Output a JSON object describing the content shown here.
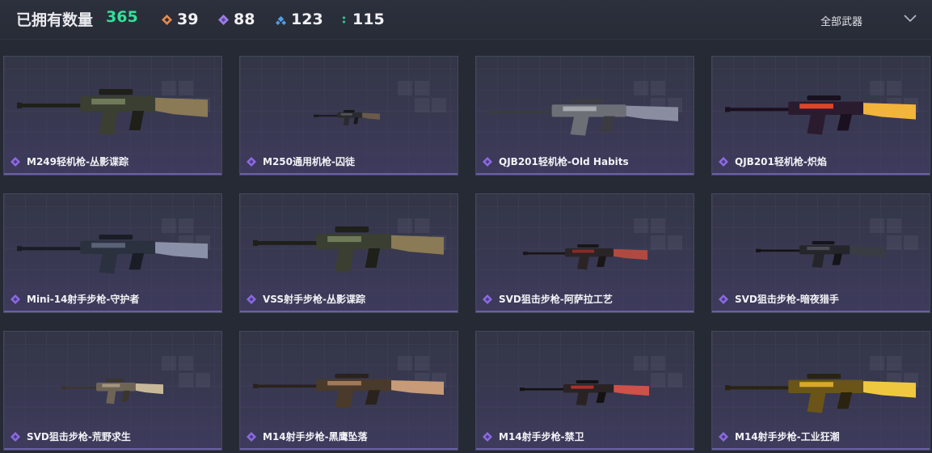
{
  "header": {
    "owned_label": "已拥有数量",
    "owned_count": "365",
    "stats": [
      {
        "icon": "orange-diamond-icon",
        "value": "39",
        "color": "#e58a4a"
      },
      {
        "icon": "purple-diamond-icon",
        "value": "88",
        "color": "#9d7de6"
      },
      {
        "icon": "blue-diamond-icon",
        "value": "123",
        "color": "#4f9fe6"
      },
      {
        "icon": "green-dot-icon",
        "value": "115",
        "color": "#2fd6a0"
      }
    ],
    "filter_label": "全部武器"
  },
  "colors": {
    "accent_green": "#2fe39a",
    "rarity_purple": "#8c6be0",
    "card_bg": "#333646"
  },
  "weapons": [
    {
      "name": "M249轻机枪-丛影谍踪",
      "rarity": "purple-diamond-icon",
      "skin": "camo-green"
    },
    {
      "name": "M250通用机枪-囚徒",
      "rarity": "purple-diamond-icon",
      "skin": "dark-small"
    },
    {
      "name": "QJB201轻机枪-Old Habits",
      "rarity": "purple-diamond-icon",
      "skin": "grey-metal"
    },
    {
      "name": "QJB201轻机枪-炽焰",
      "rarity": "purple-diamond-icon",
      "skin": "flame"
    },
    {
      "name": "Mini-14射手步枪-守护者",
      "rarity": "purple-diamond-icon",
      "skin": "dark-blue"
    },
    {
      "name": "VSS射手步枪-丛影谍踪",
      "rarity": "purple-diamond-icon",
      "skin": "camo-green"
    },
    {
      "name": "SVD狙击步枪-阿萨拉工艺",
      "rarity": "purple-diamond-icon",
      "skin": "red-wood"
    },
    {
      "name": "SVD狙击步枪-暗夜猎手",
      "rarity": "purple-diamond-icon",
      "skin": "dark"
    },
    {
      "name": "SVD狙击步枪-荒野求生",
      "rarity": "purple-diamond-icon",
      "skin": "desert-camo"
    },
    {
      "name": "M14射手步枪-黑鹰坠落",
      "rarity": "purple-diamond-icon",
      "skin": "tan-camo"
    },
    {
      "name": "M14射手步枪-禁卫",
      "rarity": "purple-diamond-icon",
      "skin": "red-black"
    },
    {
      "name": "M14射手步枪-工业狂潮",
      "rarity": "purple-diamond-icon",
      "skin": "gold"
    }
  ]
}
